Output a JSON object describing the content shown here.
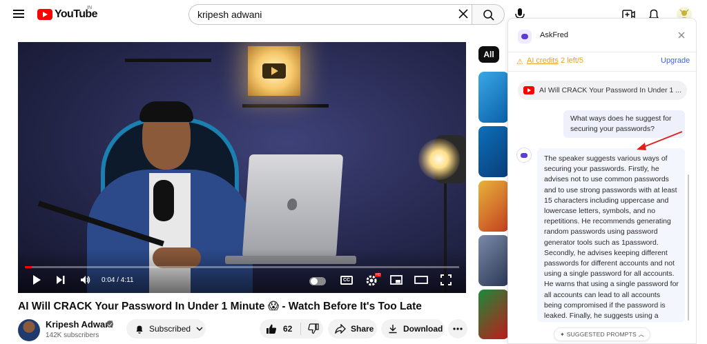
{
  "header": {
    "logo_text": "YouTube",
    "country_code": "IN",
    "search_value": "kripesh adwani",
    "search_placeholder": "Search"
  },
  "player": {
    "time": "0:04 / 4:11",
    "progress": 0.016,
    "cc_label": "CC",
    "hd_badge": "HD"
  },
  "video": {
    "title": "AI Will CRACK Your Password In Under 1 Minute 😱 - Watch Before It's Too Late",
    "channel_name": "Kripesh Adwani",
    "subscriber_count": "142K subscribers",
    "subscribed_label": "Subscribed",
    "like_count": "62",
    "share_label": "Share",
    "download_label": "Download"
  },
  "filters": {
    "chip_all": "All"
  },
  "askfred": {
    "title": "AskFred",
    "credits_link": "AI credits",
    "credits_left": "2 left/5",
    "upgrade_label": "Upgrade",
    "video_chip": "AI Will CRACK Your Password In Under 1 ...",
    "user_question": "What ways does he suggest for securing your passwords?",
    "answer": "The speaker suggests various ways of securing your passwords. Firstly, he advises not to use common passwords and to use strong passwords with at least 15 characters including uppercase and lowercase letters, symbols, and no repetitions. He recommends generating random passwords using password generator tools such as 1password. Secondly, he advises keeping different passwords for different accounts and not using a single password for all accounts. He warns that using a single password for all accounts can lead to all accounts being compromised if the password is leaked. Finally, he suggests using a password",
    "suggested_label": "SUGGESTED PROMPTS"
  },
  "colors": {
    "youtube_red": "#ff0000",
    "credits_orange": "#e8a021",
    "upgrade_blue": "#3d63dd",
    "fred_purple": "#5b3fd1"
  },
  "icons": [
    "menu-icon",
    "search-icon",
    "clear-icon",
    "mic-icon",
    "create-icon",
    "bell-icon",
    "play-icon",
    "next-icon",
    "volume-icon",
    "settings-icon",
    "miniplayer-icon",
    "theater-icon",
    "fullscreen-icon",
    "like-icon",
    "dislike-icon",
    "share-icon",
    "download-icon",
    "more-icon",
    "bell-ring-icon",
    "chevron-down-icon",
    "close-icon",
    "sparkle-icon"
  ]
}
